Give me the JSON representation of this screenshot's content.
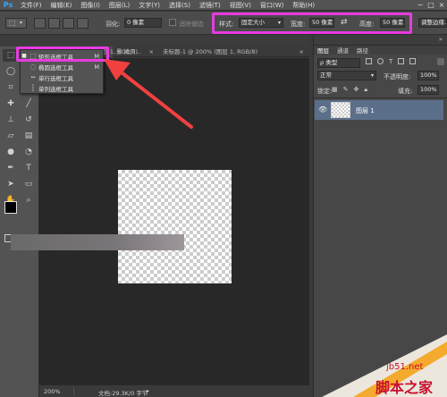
{
  "app": {
    "logo": "Ps"
  },
  "menu": [
    "文件(F)",
    "编辑(E)",
    "图像(I)",
    "图层(L)",
    "文字(Y)",
    "选择(S)",
    "滤镜(T)",
    "视图(V)",
    "窗口(W)",
    "帮助(H)"
  ],
  "window_controls": [
    "−",
    "□",
    "×"
  ],
  "options": {
    "feather_label": "羽化:",
    "feather_value": "0 像素",
    "antialias_label": "消除锯齿",
    "style_label": "样式:",
    "style_value": "固定大小",
    "width_label": "宽度:",
    "width_value": "50 像素",
    "swap_icon": "⇄",
    "height_label": "高度:",
    "height_value": "50 像素",
    "refine_label": "调整边缘..."
  },
  "tabs": [
    {
      "label": "未标题-1 @ 200% (图层 1, RGB/8)",
      "close": "×"
    },
    {
      "label": "景 拷贝...",
      "close": "×"
    },
    {
      "label": "未标题-1 @ 200% (图层 1, RGB/8)",
      "close": "×"
    }
  ],
  "flyout": {
    "items": [
      {
        "label": "矩形选框工具",
        "key": "M",
        "icon": "⬚",
        "active": true
      },
      {
        "label": "椭圆选框工具",
        "key": "M",
        "icon": "◌"
      },
      {
        "label": "单行选框工具",
        "key": "",
        "icon": "┅"
      },
      {
        "label": "单列选框工具",
        "key": "",
        "icon": "┆"
      }
    ]
  },
  "status": {
    "zoom": "200%",
    "doc_info": "文档:29.3K/0 字节"
  },
  "panel": {
    "tabs": [
      "图层",
      "通道",
      "路径"
    ],
    "filter_label": "ρ 类型",
    "blend_mode": "正常",
    "opacity_label": "不透明度:",
    "opacity_value": "100%",
    "lock_label": "锁定:",
    "fill_label": "填充:",
    "fill_value": "100%",
    "layer_name": "图层 1"
  },
  "watermark": {
    "site": "jb51.net",
    "brand": "脚本之家"
  },
  "colors": {
    "highlight": "#e83be0",
    "arrow": "#f04040",
    "selected_layer": "#5b6f8a"
  }
}
